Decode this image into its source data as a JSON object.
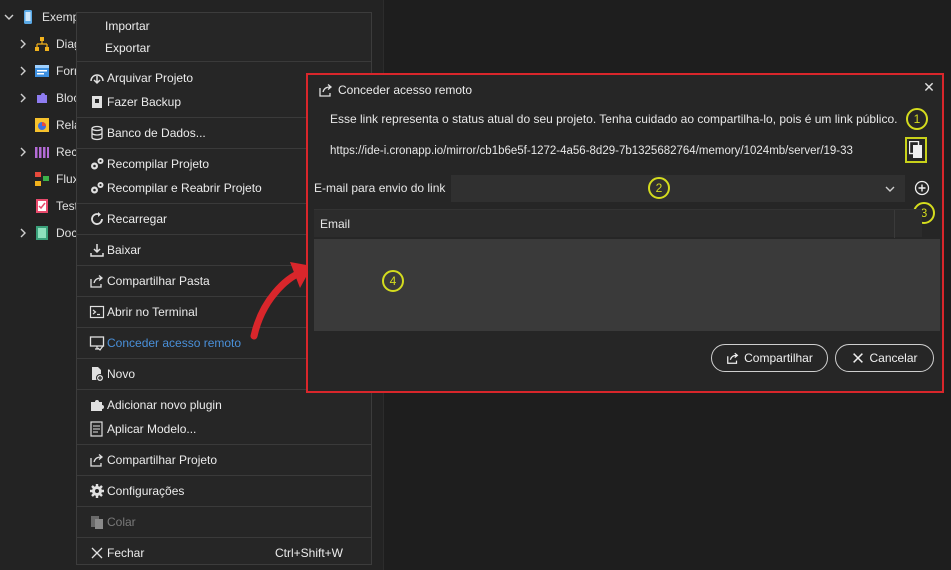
{
  "sidebar": {
    "items": [
      {
        "label": "Exempl",
        "icon": "mobile-project-icon"
      },
      {
        "label": "Diag",
        "icon": "diagram-icon"
      },
      {
        "label": "Form",
        "icon": "form-icon"
      },
      {
        "label": "Bloc",
        "icon": "blocks-icon"
      },
      {
        "label": "Rela",
        "icon": "report-icon"
      },
      {
        "label": "Rec",
        "icon": "resource-icon"
      },
      {
        "label": "Flux",
        "icon": "flow-icon"
      },
      {
        "label": "Test",
        "icon": "test-icon"
      },
      {
        "label": "Doc",
        "icon": "doc-icon"
      }
    ]
  },
  "context_menu": {
    "items": [
      {
        "label": "Importar"
      },
      {
        "label": "Exportar"
      },
      {
        "label": "Arquivar Projeto",
        "icon": "archive-icon"
      },
      {
        "label": "Fazer Backup",
        "icon": "backup-icon"
      },
      {
        "label": "Banco de Dados...",
        "icon": "database-icon"
      },
      {
        "label": "Recompilar Projeto",
        "icon": "gears-icon"
      },
      {
        "label": "Recompilar e Reabrir Projeto",
        "icon": "gears-icon"
      },
      {
        "label": "Recarregar",
        "icon": "reload-icon"
      },
      {
        "label": "Baixar",
        "icon": "download-icon"
      },
      {
        "label": "Compartilhar Pasta",
        "icon": "share-icon"
      },
      {
        "label": "Abrir no Terminal",
        "icon": "terminal-icon"
      },
      {
        "label": "Conceder acesso remoto",
        "icon": "remote-access-icon",
        "active": true
      },
      {
        "label": "Novo",
        "icon": "new-icon"
      },
      {
        "label": "Adicionar novo plugin",
        "icon": "plugin-icon"
      },
      {
        "label": "Aplicar Modelo...",
        "icon": "template-icon"
      },
      {
        "label": "Compartilhar Projeto",
        "icon": "share-icon"
      },
      {
        "label": "Configurações",
        "icon": "gear-icon"
      },
      {
        "label": "Colar",
        "icon": "paste-icon",
        "disabled": true
      },
      {
        "label": "Fechar",
        "icon": "close-icon",
        "shortcut": "Ctrl+Shift+W"
      }
    ]
  },
  "dialog": {
    "title": "Conceder acesso remoto",
    "warning": "Esse link representa o status atual do seu projeto. Tenha cuidado ao compartilha-lo, pois é um link público.",
    "link": "https://ide-i.cronapp.io/mirror/cb1b6e5f-1272-4a56-8d29-7b1325682764/memory/1024mb/server/19-33",
    "email_label": "E-mail para envio do link",
    "email_value": "",
    "table_header": "Email",
    "share_button": "Compartilhar",
    "cancel_button": "Cancelar",
    "markers": [
      "1",
      "2",
      "3",
      "4"
    ]
  },
  "colors": {
    "highlight_border": "#d9262b",
    "marker": "#d4dc1e",
    "active_item": "#4a90d9"
  }
}
